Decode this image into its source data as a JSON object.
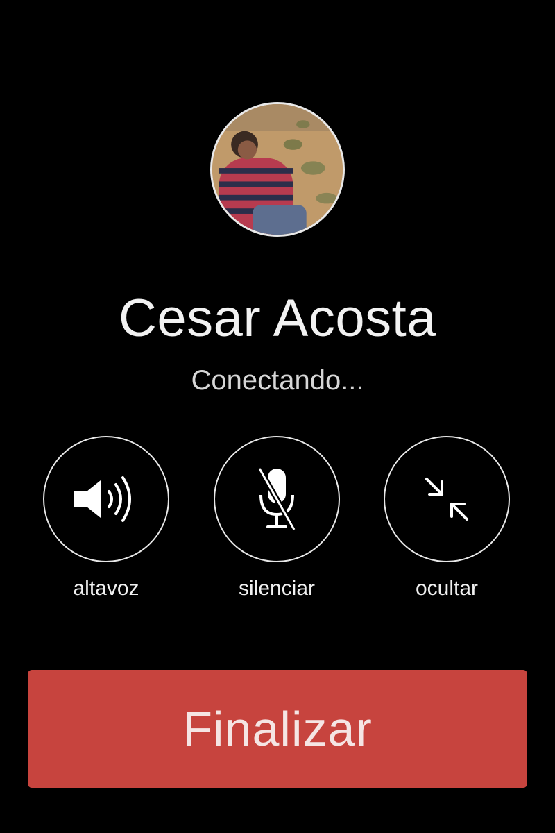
{
  "call": {
    "contact_name": "Cesar Acosta",
    "status": "Conectando..."
  },
  "controls": [
    {
      "label": "altavoz",
      "icon": "speaker-icon"
    },
    {
      "label": "silenciar",
      "icon": "microphone-muted-icon"
    },
    {
      "label": "ocultar",
      "icon": "minimize-arrows-icon"
    }
  ],
  "end_call": {
    "label": "Finalizar",
    "color": "#c7443e"
  }
}
